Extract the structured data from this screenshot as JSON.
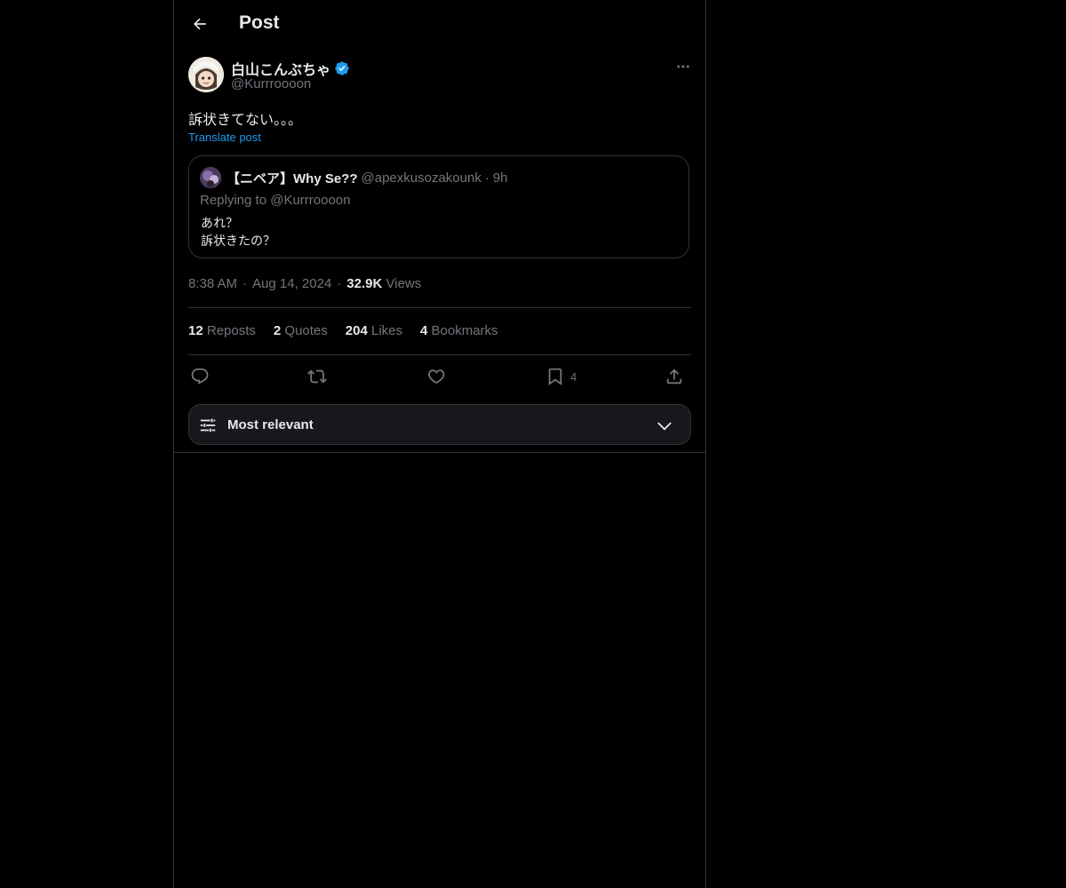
{
  "header": {
    "title": "Post"
  },
  "post": {
    "author_name": "白山こんぶちゃ",
    "author_handle": "@Kurrroooon",
    "text": "訴状きてない。。。",
    "translate_label": "Translate post",
    "time": "8:38 AM",
    "date": "Aug 14, 2024",
    "views_count": "32.9K",
    "views_label": "Views",
    "sep": "·"
  },
  "quote": {
    "name": "【ニベア】Why Se??",
    "handle": "@apexkusozakounk",
    "sep": "·",
    "time": "9h",
    "replying_to": "Replying to @Kurrroooon",
    "line1": "あれ？",
    "line2": "訴状きたの？"
  },
  "stats": {
    "reposts_count": "12",
    "reposts_label": "Reposts",
    "quotes_count": "2",
    "quotes_label": "Quotes",
    "likes_count": "204",
    "likes_label": "Likes",
    "bookmarks_count": "4",
    "bookmarks_label": "Bookmarks"
  },
  "actions": {
    "bookmark_count": "4"
  },
  "sort": {
    "label": "Most relevant"
  },
  "colors": {
    "accent": "#1d9bf0",
    "background": "#000000",
    "muted": "#71767b",
    "border": "#2f3336"
  },
  "icons": [
    "back-arrow-icon",
    "verified-badge-icon",
    "more-icon",
    "reply-icon",
    "repost-icon",
    "like-icon",
    "bookmark-icon",
    "share-icon",
    "sort-sliders-icon",
    "chevron-down-icon"
  ]
}
